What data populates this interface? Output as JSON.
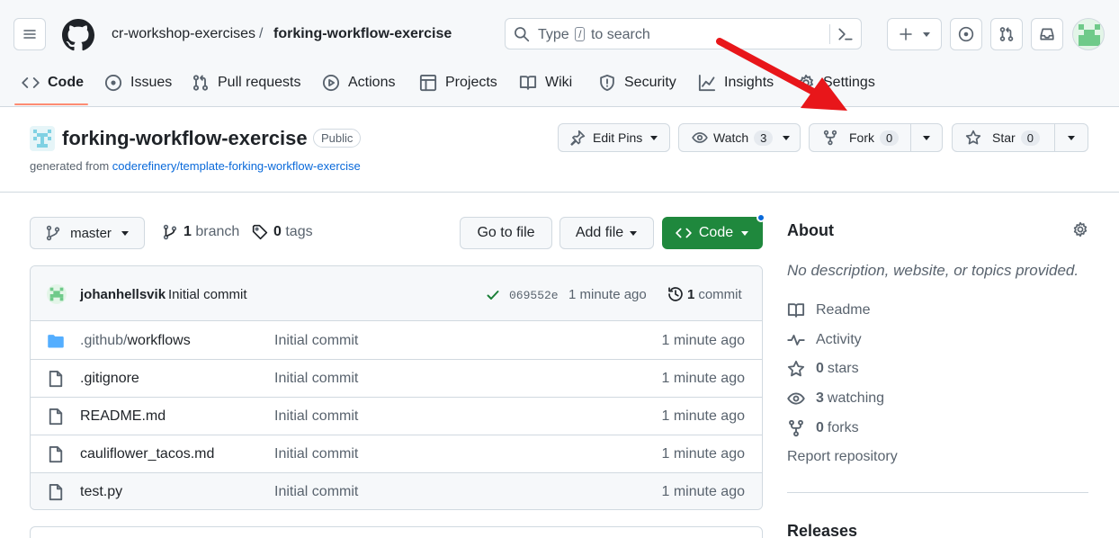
{
  "header": {
    "owner": "cr-workshop-exercises",
    "separator": "/",
    "repo": "forking-workflow-exercise",
    "search_prefix": "Type",
    "search_key": "/",
    "search_suffix": "to search"
  },
  "nav": {
    "tabs": [
      {
        "label": "Code",
        "icon": "code-icon"
      },
      {
        "label": "Issues",
        "icon": "issue-icon"
      },
      {
        "label": "Pull requests",
        "icon": "pull-request-icon"
      },
      {
        "label": "Actions",
        "icon": "play-icon"
      },
      {
        "label": "Projects",
        "icon": "table-icon"
      },
      {
        "label": "Wiki",
        "icon": "book-icon"
      },
      {
        "label": "Security",
        "icon": "shield-icon"
      },
      {
        "label": "Insights",
        "icon": "graph-icon"
      },
      {
        "label": "Settings",
        "icon": "gear-icon"
      }
    ]
  },
  "repo": {
    "name": "forking-workflow-exercise",
    "visibility": "Public",
    "generated_prefix": "generated from",
    "template_link": "coderefinery/template-forking-workflow-exercise",
    "actions": {
      "edit_pins": "Edit Pins",
      "watch": "Watch",
      "watch_count": "3",
      "fork": "Fork",
      "fork_count": "0",
      "star": "Star",
      "star_count": "0"
    }
  },
  "browser": {
    "branch": "master",
    "branch_count": "1",
    "branch_label": "branch",
    "tag_count": "0",
    "tag_label": "tags",
    "go_to_file": "Go to file",
    "add_file": "Add file",
    "code": "Code"
  },
  "commit": {
    "author": "johanhellsvik",
    "message": "Initial commit",
    "sha": "069552e",
    "time": "1 minute ago",
    "count": "1",
    "count_label": "commit"
  },
  "files": [
    {
      "prefix": ".github/",
      "name": "workflows",
      "message": "Initial commit",
      "age": "1 minute ago",
      "type": "folder"
    },
    {
      "prefix": "",
      "name": ".gitignore",
      "message": "Initial commit",
      "age": "1 minute ago",
      "type": "file"
    },
    {
      "prefix": "",
      "name": "README.md",
      "message": "Initial commit",
      "age": "1 minute ago",
      "type": "file"
    },
    {
      "prefix": "",
      "name": "cauliflower_tacos.md",
      "message": "Initial commit",
      "age": "1 minute ago",
      "type": "file"
    },
    {
      "prefix": "",
      "name": "test.py",
      "message": "Initial commit",
      "age": "1 minute ago",
      "type": "file"
    }
  ],
  "about": {
    "title": "About",
    "description": "No description, website, or topics provided.",
    "readme": "Readme",
    "activity": "Activity",
    "stars_count": "0",
    "stars_label": "stars",
    "watching_count": "3",
    "watching_label": "watching",
    "forks_count": "0",
    "forks_label": "forks",
    "report": "Report repository",
    "releases": "Releases"
  },
  "colors": {
    "accent_green": "#1f883d",
    "link_blue": "#0969da",
    "annotation_arrow": "#e8161a",
    "tab_underline": "#fd8c73"
  }
}
